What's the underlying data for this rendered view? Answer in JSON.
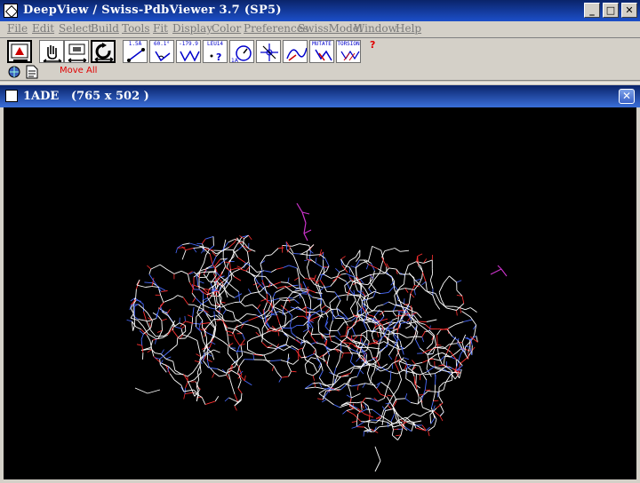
{
  "app": {
    "title": "DeepView / Swiss-PdbViewer 3.7 (SP5)",
    "window_buttons": {
      "minimize": "_",
      "maximize": "□",
      "close": "✕"
    }
  },
  "menu": [
    "File",
    "Edit",
    "Select",
    "Build",
    "Tools",
    "Fit",
    "Display",
    "Color",
    "Preferences",
    "SwissModel",
    "Window",
    "Help"
  ],
  "toolbar": {
    "tools": [
      {
        "name": "reset-view",
        "icon": "reset-view-icon"
      },
      {
        "name": "move",
        "icon": "hand-icon"
      },
      {
        "name": "zoom",
        "icon": "zoom-icon"
      },
      {
        "name": "rotate",
        "icon": "rotate-icon"
      },
      {
        "name": "distance",
        "label": "1.5Å",
        "icon": "distance-icon"
      },
      {
        "name": "angle",
        "label": "60.1°",
        "icon": "angle-icon"
      },
      {
        "name": "torsion",
        "label": "-179.9",
        "icon": "torsion-icon"
      },
      {
        "name": "identify",
        "label": "LEU14",
        "icon": "identify-icon"
      },
      {
        "name": "center",
        "icon": "center-icon"
      },
      {
        "name": "neighbors",
        "icon": "neighbors-icon"
      },
      {
        "name": "mutate",
        "label": "MUTATE",
        "icon": "mutate-icon"
      },
      {
        "name": "torsion-sc",
        "label": "TORSION",
        "icon": "sidechain-icon"
      }
    ],
    "help": "?",
    "move_all": "Move All"
  },
  "child_window": {
    "title": "1ADE",
    "size": "(765 x 502 )"
  },
  "colors": {
    "titlebar": "#0a246a",
    "chrome": "#d4d0c8",
    "viewport_bg": "#000000",
    "bond_carbon": "#ffffff",
    "bond_oxygen": "#ff3030",
    "bond_nitrogen": "#4a6cff",
    "ligand": "#cc33cc",
    "accent_red": "#e00000"
  }
}
